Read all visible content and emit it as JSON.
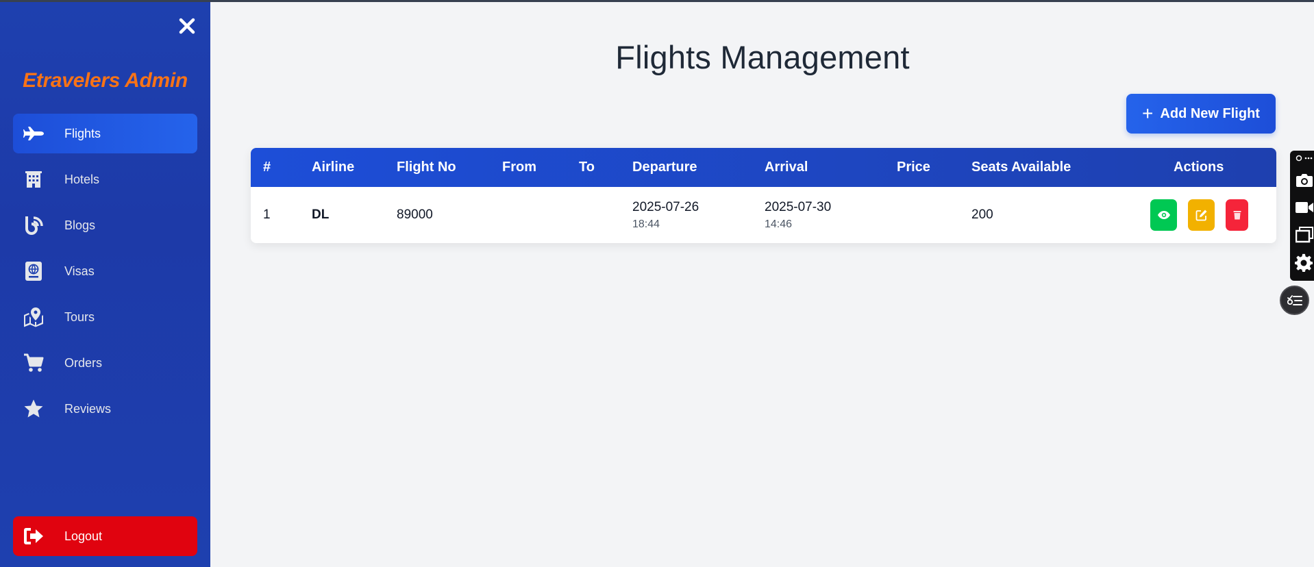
{
  "sidebar": {
    "brand": "Etravelers Admin",
    "items": [
      {
        "label": "Flights",
        "icon": "plane-icon",
        "active": true
      },
      {
        "label": "Hotels",
        "icon": "building-icon"
      },
      {
        "label": "Blogs",
        "icon": "blog-icon"
      },
      {
        "label": "Visas",
        "icon": "passport-icon"
      },
      {
        "label": "Tours",
        "icon": "map-icon"
      },
      {
        "label": "Orders",
        "icon": "cart-icon"
      },
      {
        "label": "Reviews",
        "icon": "star-icon"
      }
    ],
    "logout_label": "Logout"
  },
  "main": {
    "title": "Flights Management",
    "add_button": "Add New Flight",
    "table": {
      "headers": [
        "#",
        "Airline",
        "Flight No",
        "From",
        "To",
        "Departure",
        "Arrival",
        "Price",
        "Seats Available",
        "Actions"
      ],
      "rows": [
        {
          "index": "1",
          "airline": "DL",
          "flight_no": "89000",
          "from": "",
          "to": "",
          "departure_date": "2025-07-26",
          "departure_time": "18:44",
          "arrival_date": "2025-07-30",
          "arrival_time": "14:46",
          "price": "",
          "seats": "200"
        }
      ]
    }
  },
  "colors": {
    "sidebar_bg": "#1e40af",
    "brand": "#f97316",
    "active_item": "#1d4ed8",
    "logout": "#e0030f",
    "view": "#00c853",
    "edit": "#f2b100",
    "delete": "#f5243a"
  }
}
